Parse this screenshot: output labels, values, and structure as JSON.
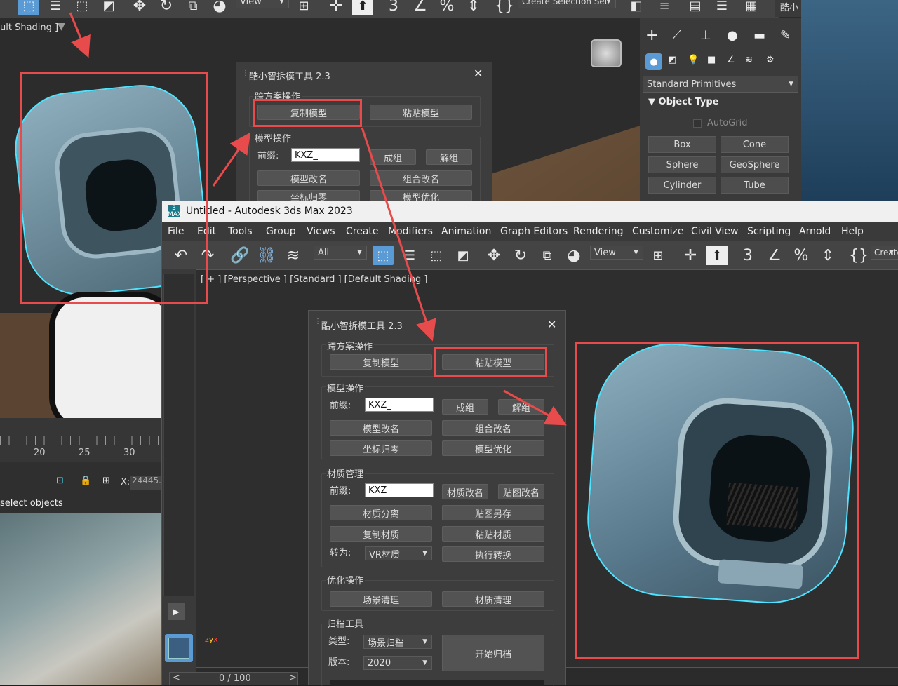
{
  "back_window": {
    "viewport_label": "ult Shading ]",
    "view_dropdown": "View",
    "selection_set": "Create Selection Set",
    "right_title_fragment": "酷小",
    "command_panel": {
      "category_dropdown": "Standard Primitives",
      "rollout_title": "Object Type",
      "autogrid": "AutoGrid",
      "buttons": [
        "Box",
        "Cone",
        "Sphere",
        "GeoSphere",
        "Cylinder",
        "Tube"
      ]
    },
    "dialog": {
      "title": "酷小智拆模工具 2.3",
      "group1_title": "跨方案操作",
      "copy_model": "复制模型",
      "paste_model": "粘贴模型",
      "group2_title": "模型操作",
      "prefix_label": "前缀:",
      "prefix_value": "KXZ_",
      "group": "成组",
      "ungroup": "解组",
      "rename_model": "模型改名",
      "rename_group": "组合改名",
      "reset_coord": "坐标归零",
      "optimize_model": "模型优化"
    },
    "timeline_ticks": [
      "20",
      "25",
      "30"
    ],
    "coord_x_label": "X:",
    "coord_x_value": "24445.",
    "status_text": "select objects"
  },
  "front_window": {
    "app_icon": "3 MAX",
    "title": "Untitled - Autodesk 3ds Max 2023",
    "menu": [
      "File",
      "Edit",
      "Tools",
      "Group",
      "Views",
      "Create",
      "Modifiers",
      "Animation",
      "Graph Editors",
      "Rendering",
      "Customize",
      "Civil View",
      "Scripting",
      "Arnold",
      "Help"
    ],
    "filter_dropdown": "All",
    "view_dropdown": "View",
    "create_fragment": "Create",
    "viewport_label": "[ + ] [Perspective ]  [Standard ]  [Default Shading ]",
    "frame_counter": "0 / 100",
    "dialog": {
      "title": "酷小智拆模工具 2.3",
      "group1_title": "跨方案操作",
      "copy_model": "复制模型",
      "paste_model": "粘贴模型",
      "group2_title": "模型操作",
      "prefix_label": "前缀:",
      "prefix_value": "KXZ_",
      "group": "成组",
      "ungroup": "解组",
      "rename_model": "模型改名",
      "rename_group": "组合改名",
      "reset_coord": "坐标归零",
      "optimize_model": "模型优化",
      "group3_title": "材质管理",
      "mat_prefix_label": "前缀:",
      "mat_prefix_value": "KXZ_",
      "rename_material": "材质改名",
      "rename_map": "贴图改名",
      "split_material": "材质分离",
      "save_map_as": "贴图另存",
      "copy_material": "复制材质",
      "paste_material": "粘贴材质",
      "convert_label": "转为:",
      "convert_value": "VR材质",
      "execute_convert": "执行转换",
      "group4_title": "优化操作",
      "scene_clean": "场景清理",
      "material_clean": "材质清理",
      "group5_title": "归档工具",
      "type_label": "类型:",
      "type_value": "场景归档",
      "version_label": "版本:",
      "version_value": "2020",
      "start_archive": "开始归档"
    }
  },
  "colors": {
    "annotation_red": "#e84b4b",
    "ui_dark": "#2b2b2b",
    "selection_cyan": "#4fe3ff",
    "active_blue": "#5b9bd5"
  }
}
